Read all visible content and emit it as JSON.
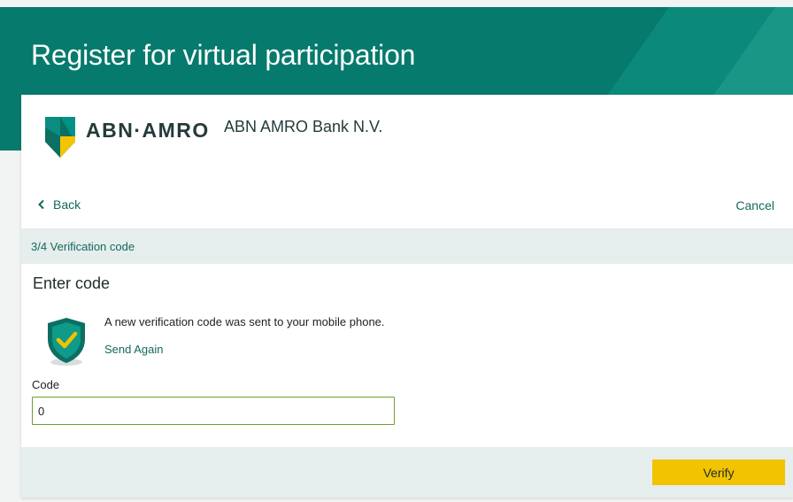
{
  "header": {
    "title": "Register for virtual participation"
  },
  "bank": {
    "logo_text": "ABN·AMRO",
    "name": "ABN AMRO Bank N.V."
  },
  "nav": {
    "back_label": "Back",
    "cancel_label": "Cancel"
  },
  "step": {
    "label": "3/4 Verification code"
  },
  "form": {
    "title": "Enter code",
    "info_text": "A new verification code was sent to your mobile phone.",
    "send_again_label": "Send Again",
    "code_label": "Code",
    "code_value": "0",
    "verify_label": "Verify"
  },
  "colors": {
    "brand_green": "#067a6c",
    "link_green": "#14685d",
    "accent_yellow": "#f2c300",
    "step_bar_bg": "#e5eeec",
    "input_border": "#6da02e"
  },
  "icons": {
    "logo": "abn-amro-shield-icon",
    "back": "chevron-left-icon",
    "verification": "shield-check-icon"
  }
}
